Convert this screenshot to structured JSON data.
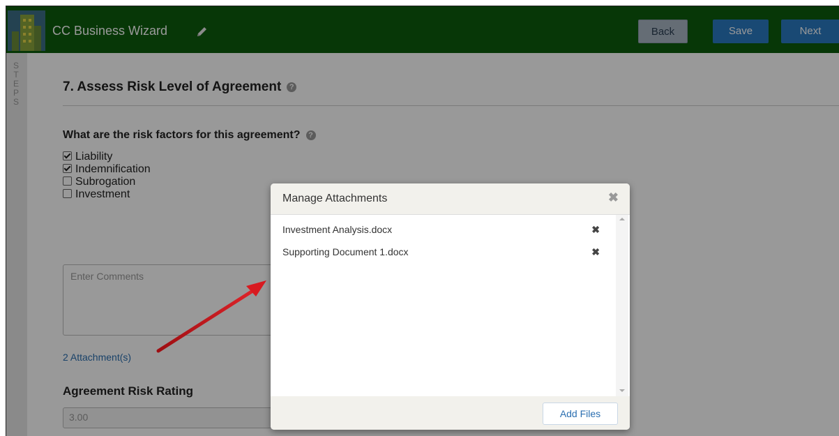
{
  "header": {
    "title": "CC Business Wizard",
    "back_label": "Back",
    "save_label": "Save",
    "next_label": "Next"
  },
  "sidebar": {
    "label": "S T E P S"
  },
  "section": {
    "title": "7. Assess Risk Level of Agreement",
    "help_glyph": "?"
  },
  "question": {
    "text": "What are the risk factors for this agreement?",
    "help_glyph": "?"
  },
  "risk_factors": [
    {
      "label": "Liability",
      "checked": true
    },
    {
      "label": "Indemnification",
      "checked": true
    },
    {
      "label": "Subrogation",
      "checked": false
    },
    {
      "label": "Investment",
      "checked": false
    }
  ],
  "comments": {
    "placeholder": "Enter Comments"
  },
  "attachments_link": "2 Attachment(s)",
  "rating": {
    "label": "Agreement Risk Rating",
    "value": "3.00"
  },
  "modal": {
    "title": "Manage Attachments",
    "close_glyph": "✖",
    "files": [
      {
        "name": "Investment Analysis.docx",
        "remove_glyph": "✖"
      },
      {
        "name": "Supporting Document 1.docx",
        "remove_glyph": "✖"
      }
    ],
    "add_files_label": "Add Files"
  },
  "colors": {
    "header_bg": "#0c5c0c",
    "primary_button": "#2a7ac2",
    "link": "#2a6eb0",
    "annotation_arrow": "#d0161c"
  },
  "icons": {
    "logo": "building-logo-icon",
    "edit": "pencil-icon",
    "help": "question-circle-icon",
    "close": "close-icon",
    "remove": "remove-x-icon"
  }
}
